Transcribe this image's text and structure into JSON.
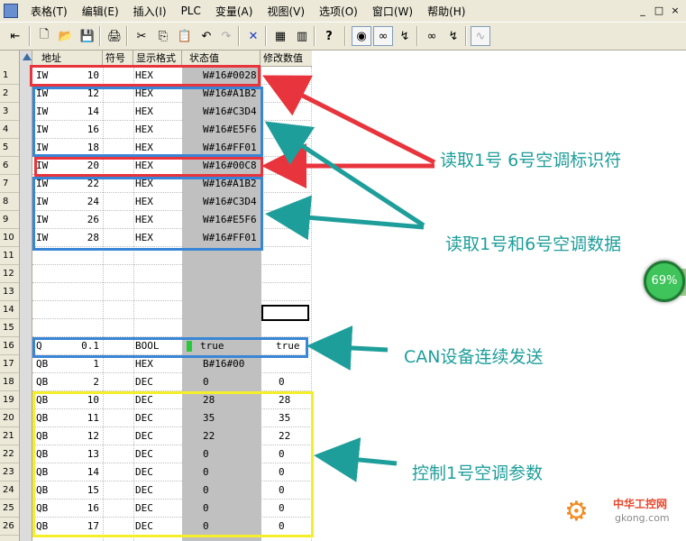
{
  "menu": {
    "items": [
      "表格(T)",
      "编辑(E)",
      "插入(I)",
      "PLC",
      "变量(A)",
      "视图(V)",
      "选项(O)",
      "窗口(W)",
      "帮助(H)"
    ],
    "window_controls": [
      "_",
      "□",
      "×"
    ]
  },
  "toolbar": {
    "icons": [
      "pin-icon",
      "new-file-icon",
      "open-folder-icon",
      "save-icon",
      "print-icon",
      "cut-icon",
      "copy-icon",
      "paste-icon",
      "undo-icon",
      "redo-icon",
      "delete-icon",
      "monitor-icon",
      "variable-icon",
      "help-pointer-icon",
      "watch-icon",
      "glasses-icon",
      "trigger-icon",
      "glasses2-icon",
      "trigger2-icon",
      "modify-disabled-icon"
    ],
    "glyphs": [
      "⇤",
      "🗋",
      "📂",
      "💾",
      "🖨",
      "✂",
      "⎘",
      "📋",
      "↶",
      "↷",
      "✕",
      "▦",
      "▥",
      "?",
      "◉",
      "∞",
      "↯",
      "∞",
      "↯",
      "∿"
    ]
  },
  "table": {
    "headers": [
      "地址",
      "符号",
      "显示格式",
      "状态值",
      "修改数值"
    ],
    "rows": [
      {
        "num": "1",
        "addr_type": "IW",
        "addr_num": "10",
        "format": "HEX",
        "status": "W#16#0028",
        "modify": ""
      },
      {
        "num": "2",
        "addr_type": "IW",
        "addr_num": "12",
        "format": "HEX",
        "status": "W#16#A1B2",
        "modify": ""
      },
      {
        "num": "3",
        "addr_type": "IW",
        "addr_num": "14",
        "format": "HEX",
        "status": "W#16#C3D4",
        "modify": ""
      },
      {
        "num": "4",
        "addr_type": "IW",
        "addr_num": "16",
        "format": "HEX",
        "status": "W#16#E5F6",
        "modify": ""
      },
      {
        "num": "5",
        "addr_type": "IW",
        "addr_num": "18",
        "format": "HEX",
        "status": "W#16#FF01",
        "modify": ""
      },
      {
        "num": "6",
        "addr_type": "IW",
        "addr_num": "20",
        "format": "HEX",
        "status": "W#16#00C8",
        "modify": ""
      },
      {
        "num": "7",
        "addr_type": "IW",
        "addr_num": "22",
        "format": "HEX",
        "status": "W#16#A1B2",
        "modify": ""
      },
      {
        "num": "8",
        "addr_type": "IW",
        "addr_num": "24",
        "format": "HEX",
        "status": "W#16#C3D4",
        "modify": ""
      },
      {
        "num": "9",
        "addr_type": "IW",
        "addr_num": "26",
        "format": "HEX",
        "status": "W#16#E5F6",
        "modify": ""
      },
      {
        "num": "10",
        "addr_type": "IW",
        "addr_num": "28",
        "format": "HEX",
        "status": "W#16#FF01",
        "modify": ""
      },
      {
        "num": "11",
        "addr_type": "",
        "addr_num": "",
        "format": "",
        "status": "",
        "modify": ""
      },
      {
        "num": "12",
        "addr_type": "",
        "addr_num": "",
        "format": "",
        "status": "",
        "modify": ""
      },
      {
        "num": "13",
        "addr_type": "",
        "addr_num": "",
        "format": "",
        "status": "",
        "modify": ""
      },
      {
        "num": "14",
        "addr_type": "",
        "addr_num": "",
        "format": "",
        "status": "",
        "modify": ""
      },
      {
        "num": "15",
        "addr_type": "",
        "addr_num": "",
        "format": "",
        "status": "",
        "modify": ""
      },
      {
        "num": "16",
        "addr_type": "Q",
        "addr_num": "0.1",
        "format": "BOOL",
        "status": "true",
        "modify": "true",
        "indicator": "green"
      },
      {
        "num": "17",
        "addr_type": "QB",
        "addr_num": "1",
        "format": "HEX",
        "status": "B#16#00",
        "modify": ""
      },
      {
        "num": "18",
        "addr_type": "QB",
        "addr_num": "2",
        "format": "DEC",
        "status": "0",
        "modify": "0"
      },
      {
        "num": "19",
        "addr_type": "QB",
        "addr_num": "10",
        "format": "DEC",
        "status": "28",
        "modify": "28"
      },
      {
        "num": "20",
        "addr_type": "QB",
        "addr_num": "11",
        "format": "DEC",
        "status": "35",
        "modify": "35"
      },
      {
        "num": "21",
        "addr_type": "QB",
        "addr_num": "12",
        "format": "DEC",
        "status": "22",
        "modify": "22"
      },
      {
        "num": "22",
        "addr_type": "QB",
        "addr_num": "13",
        "format": "DEC",
        "status": "0",
        "modify": "0"
      },
      {
        "num": "23",
        "addr_type": "QB",
        "addr_num": "14",
        "format": "DEC",
        "status": "0",
        "modify": "0"
      },
      {
        "num": "24",
        "addr_type": "QB",
        "addr_num": "15",
        "format": "DEC",
        "status": "0",
        "modify": "0"
      },
      {
        "num": "25",
        "addr_type": "QB",
        "addr_num": "16",
        "format": "DEC",
        "status": "0",
        "modify": "0"
      },
      {
        "num": "26",
        "addr_type": "QB",
        "addr_num": "17",
        "format": "DEC",
        "status": "0",
        "modify": "0"
      }
    ]
  },
  "annotations": {
    "read_identifier": "读取1号 6号空调标识符",
    "read_data": "读取1号和6号空调数据",
    "can_send": "CAN设备连续发送",
    "control_params": "控制1号空调参数"
  },
  "colors": {
    "red": "#e8343c",
    "blue": "#3a86d6",
    "yellow": "#f5ee2a",
    "teal": "#1e9e9a"
  },
  "badge": {
    "text": "69%"
  },
  "watermark": {
    "line1": "中华工控网",
    "line2": "gkong.com"
  }
}
